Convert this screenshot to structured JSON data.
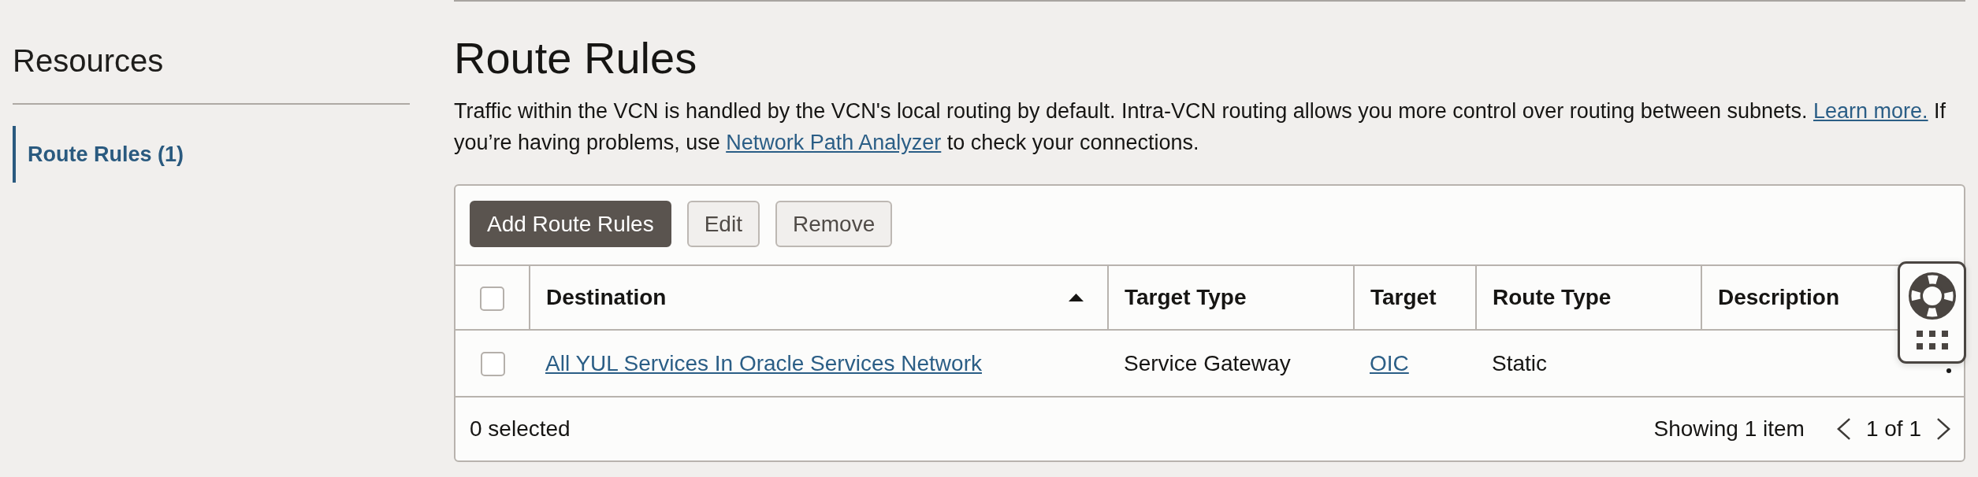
{
  "sidebar": {
    "title": "Resources",
    "items": [
      {
        "label": "Route Rules (1)",
        "selected": true
      }
    ]
  },
  "page": {
    "title": "Route Rules",
    "description": [
      {
        "kind": "text",
        "text": "Traffic within the VCN is handled by the VCN's local routing by default. Intra-VCN routing allows you more control over routing between subnets. "
      },
      {
        "kind": "link",
        "text": "Learn more."
      },
      {
        "kind": "text",
        "text": " If you’re having problems, use "
      },
      {
        "kind": "link",
        "text": "Network Path Analyzer"
      },
      {
        "kind": "text",
        "text": " to check your connections."
      }
    ]
  },
  "toolbar": {
    "buttons": [
      {
        "label": "Add Route Rules",
        "kind": "primary"
      },
      {
        "label": "Edit",
        "kind": "secondary"
      },
      {
        "label": "Remove",
        "kind": "secondary"
      }
    ]
  },
  "table": {
    "select_all": {
      "checked": false
    },
    "columns": [
      {
        "label": "Destination",
        "sorted": true
      },
      {
        "label": "Target Type",
        "sorted": false
      },
      {
        "label": "Target",
        "sorted": false
      },
      {
        "label": "Route Type",
        "sorted": false
      },
      {
        "label": "Description",
        "sorted": false
      }
    ],
    "rows": [
      {
        "checked": false,
        "cells": [
          {
            "kind": "link",
            "text": "All YUL Services In Oracle Services Network"
          },
          {
            "kind": "text",
            "text": "Service Gateway"
          },
          {
            "kind": "link",
            "text": "OIC"
          },
          {
            "kind": "text",
            "text": "Static"
          }
        ]
      }
    ],
    "footer": {
      "selection": "0 selected",
      "summary": "Showing 1 item",
      "page": "1 of 1"
    }
  }
}
